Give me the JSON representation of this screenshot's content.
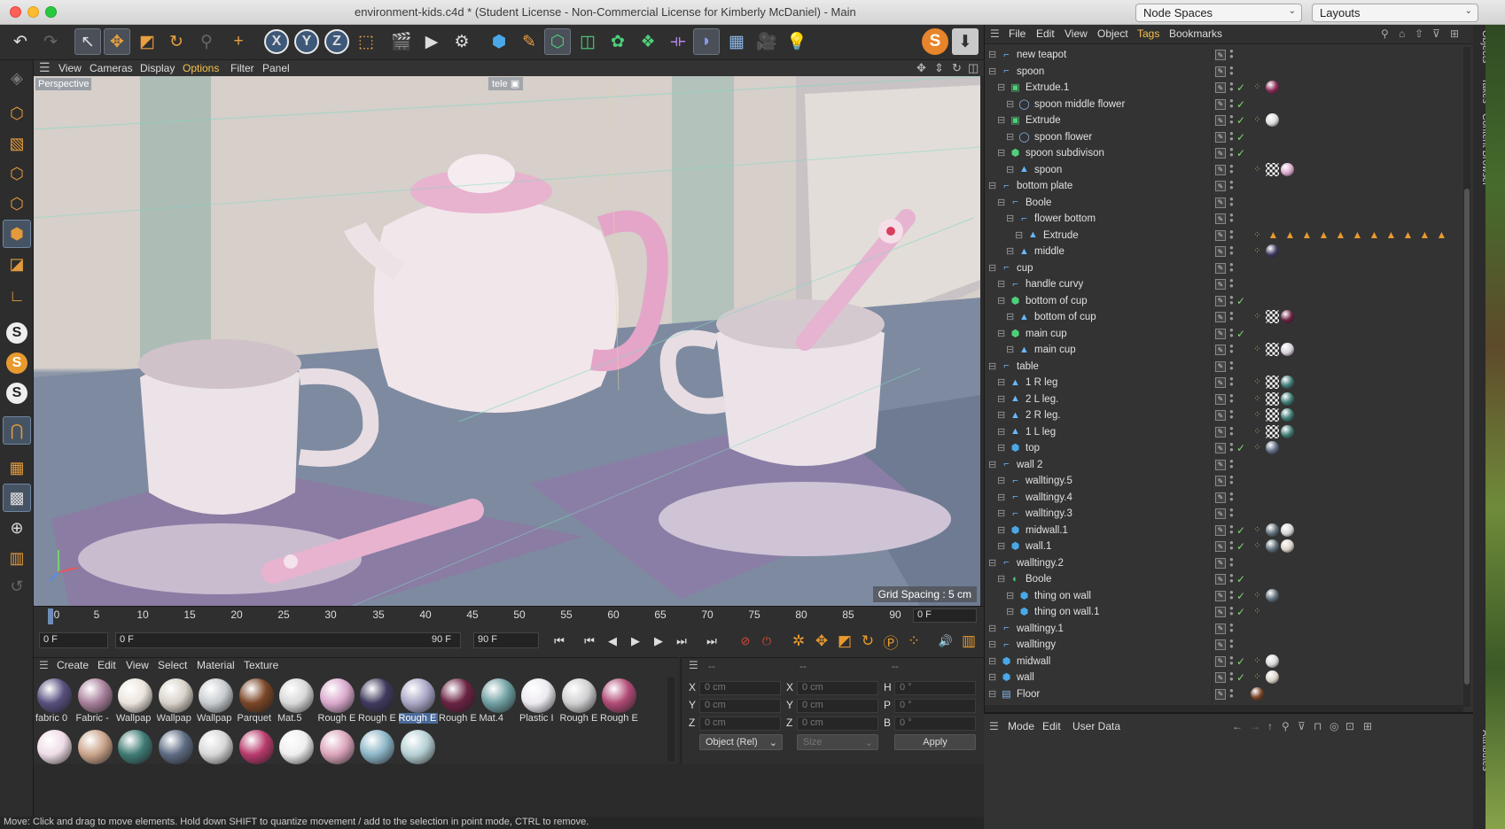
{
  "window": {
    "title": "environment-kids.c4d * (Student License - Non-Commercial License for Kimberly McDaniel) - Main",
    "node_spaces_label": "Node Spaces",
    "layouts_label": "Layouts"
  },
  "viewport": {
    "menu": [
      "View",
      "Cameras",
      "Display",
      "Options",
      "Filter",
      "Panel"
    ],
    "view_label": "Perspective",
    "camera_tag": "tele",
    "grid_spacing": "Grid Spacing : 5 cm"
  },
  "timeline": {
    "ticks": [
      "0",
      "5",
      "10",
      "15",
      "20",
      "25",
      "30",
      "35",
      "40",
      "45",
      "50",
      "55",
      "60",
      "65",
      "70",
      "75",
      "80",
      "85",
      "90"
    ],
    "current_frame": "0 F",
    "start_frame": "0 F",
    "range_start": "0 F",
    "range_end": "90 F",
    "end_frame": "90 F"
  },
  "materials": {
    "menu": [
      "Create",
      "Edit",
      "View",
      "Select",
      "Material",
      "Texture"
    ],
    "row1": [
      {
        "label": "fabric 0",
        "color": "#58507f"
      },
      {
        "label": "Fabric -",
        "color": "#a87f9a"
      },
      {
        "label": "Wallpap",
        "color": "#ebe4dc"
      },
      {
        "label": "Wallpap",
        "color": "#d8d2c8"
      },
      {
        "label": "Wallpap",
        "color": "#c8ccd0"
      },
      {
        "label": "Parquet",
        "color": "#7a4526"
      },
      {
        "label": "Mat.5",
        "color": "#d8d8d8"
      },
      {
        "label": "Rough E",
        "color": "#d9a8cc"
      },
      {
        "label": "Rough E",
        "color": "#3f3a5e"
      },
      {
        "label": "Rough E",
        "color": "#a9a6c6"
      },
      {
        "label": "Rough E",
        "color": "#6b2243"
      },
      {
        "label": "Mat.4",
        "color": "#6f9fa2"
      },
      {
        "label": "Plastic I",
        "color": "#eceaf0"
      },
      {
        "label": "Rough E",
        "color": "#d0d0d2"
      },
      {
        "label": "Rough E",
        "color": "#b14a76"
      }
    ],
    "row2_colors": [
      "#efdce6",
      "#caa38a",
      "#3f7b75",
      "#5d6b82",
      "#d7d7d7",
      "#b83a6c",
      "#eeeeee",
      "#dba4bb",
      "#8cb5c7",
      "#b5d0d4"
    ]
  },
  "coordinates": {
    "headers": [
      "--",
      "--",
      "--"
    ],
    "rows": [
      {
        "a": "X",
        "av": "0 cm",
        "b": "X",
        "bv": "0 cm",
        "c": "H",
        "cv": "0 °"
      },
      {
        "a": "Y",
        "av": "0 cm",
        "b": "Y",
        "bv": "0 cm",
        "c": "P",
        "cv": "0 °"
      },
      {
        "a": "Z",
        "av": "0 cm",
        "b": "Z",
        "bv": "0 cm",
        "c": "B",
        "cv": "0 °"
      }
    ],
    "mode_select": "Object (Rel)",
    "size_select": "Size",
    "apply_label": "Apply"
  },
  "status_text": "Move: Click and drag to move elements. Hold down SHIFT to quantize movement / add to the selection in point mode, CTRL to remove.",
  "object_manager": {
    "menu": [
      "File",
      "Edit",
      "View",
      "Object",
      "Tags",
      "Bookmarks"
    ],
    "rows": [
      {
        "name": "new teapot",
        "depth": 0,
        "icon": "null",
        "check": false,
        "tags": []
      },
      {
        "name": "spoon",
        "depth": 0,
        "icon": "null",
        "check": false,
        "tags": []
      },
      {
        "name": "Extrude.1",
        "depth": 1,
        "icon": "extrude",
        "check": true,
        "tags": [
          "phong",
          "#8a2a55"
        ]
      },
      {
        "name": "spoon middle flower",
        "depth": 2,
        "icon": "spline",
        "check": true,
        "tags": []
      },
      {
        "name": "Extrude",
        "depth": 1,
        "icon": "extrude",
        "check": true,
        "tags": [
          "phong",
          "#dcdcdc"
        ]
      },
      {
        "name": "spoon flower",
        "depth": 2,
        "icon": "spline",
        "check": true,
        "tags": []
      },
      {
        "name": "spoon subdivison",
        "depth": 1,
        "icon": "subdiv",
        "check": true,
        "tags": []
      },
      {
        "name": "spoon",
        "depth": 2,
        "icon": "poly",
        "check": false,
        "tags": [
          "phong",
          "uvw",
          "#d9a8cc"
        ]
      },
      {
        "name": "bottom plate",
        "depth": 0,
        "icon": "null",
        "check": false,
        "tags": []
      },
      {
        "name": "Boole",
        "depth": 1,
        "icon": "null",
        "check": false,
        "tags": []
      },
      {
        "name": "flower bottom",
        "depth": 2,
        "icon": "null",
        "check": false,
        "tags": []
      },
      {
        "name": "Extrude",
        "depth": 3,
        "icon": "poly",
        "check": false,
        "tags": [
          "phong",
          "warn",
          "warn",
          "warn",
          "warn",
          "warn",
          "warn",
          "warn",
          "warn",
          "warn",
          "warn",
          "warn"
        ]
      },
      {
        "name": "middle",
        "depth": 2,
        "icon": "poly",
        "check": false,
        "tags": [
          "phong",
          "#3f3a5e"
        ]
      },
      {
        "name": "cup",
        "depth": 0,
        "icon": "null",
        "check": false,
        "tags": []
      },
      {
        "name": "handle curvy",
        "depth": 1,
        "icon": "null",
        "check": false,
        "tags": []
      },
      {
        "name": "bottom of cup",
        "depth": 1,
        "icon": "subdiv",
        "check": true,
        "tags": []
      },
      {
        "name": "bottom of cup",
        "depth": 2,
        "icon": "poly",
        "check": false,
        "tags": [
          "phong",
          "uvw",
          "#6b2243"
        ]
      },
      {
        "name": "main cup",
        "depth": 1,
        "icon": "subdiv",
        "check": true,
        "tags": []
      },
      {
        "name": "main cup",
        "depth": 2,
        "icon": "poly",
        "check": false,
        "tags": [
          "phong",
          "uvw",
          "#d8d0dc"
        ]
      },
      {
        "name": "table",
        "depth": 0,
        "icon": "null",
        "check": false,
        "tags": []
      },
      {
        "name": "1 R leg",
        "depth": 1,
        "icon": "poly",
        "check": false,
        "tags": [
          "phong",
          "uvw",
          "#3f7b75"
        ]
      },
      {
        "name": "2 L leg.",
        "depth": 1,
        "icon": "poly",
        "check": false,
        "tags": [
          "phong",
          "uvw",
          "#3f7b75"
        ]
      },
      {
        "name": "2 R leg.",
        "depth": 1,
        "icon": "poly",
        "check": false,
        "tags": [
          "phong",
          "uvw",
          "#3f7b75"
        ]
      },
      {
        "name": "1 L leg",
        "depth": 1,
        "icon": "poly",
        "check": false,
        "tags": [
          "phong",
          "uvw",
          "#3f7b75"
        ]
      },
      {
        "name": "top",
        "depth": 1,
        "icon": "cube",
        "check": true,
        "tags": [
          "phong",
          "#5d6b82"
        ]
      },
      {
        "name": "wall  2",
        "depth": 0,
        "icon": "null",
        "check": false,
        "tags": []
      },
      {
        "name": "walltingy.5",
        "depth": 1,
        "icon": "null",
        "check": false,
        "tags": []
      },
      {
        "name": "walltingy.4",
        "depth": 1,
        "icon": "null",
        "check": false,
        "tags": []
      },
      {
        "name": "walltingy.3",
        "depth": 1,
        "icon": "null",
        "check": false,
        "tags": []
      },
      {
        "name": "midwall.1",
        "depth": 1,
        "icon": "cube",
        "check": true,
        "tags": [
          "phong",
          "#5f6f7a",
          "#d7d7d7"
        ]
      },
      {
        "name": "wall.1",
        "depth": 1,
        "icon": "cube",
        "check": true,
        "tags": [
          "phong",
          "#5f6f7a",
          "#d8d2c8"
        ]
      },
      {
        "name": "walltingy.2",
        "depth": 0,
        "icon": "null",
        "check": false,
        "tags": []
      },
      {
        "name": "Boole",
        "depth": 1,
        "icon": "boole",
        "check": true,
        "tags": []
      },
      {
        "name": "thing on wall",
        "depth": 2,
        "icon": "cube",
        "check": true,
        "tags": [
          "phong",
          "#5f6f7a"
        ]
      },
      {
        "name": "thing on wall.1",
        "depth": 2,
        "icon": "cube",
        "check": true,
        "tags": [
          "phong"
        ]
      },
      {
        "name": "walltingy.1",
        "depth": 0,
        "icon": "null",
        "check": false,
        "tags": []
      },
      {
        "name": "walltingy",
        "depth": 0,
        "icon": "null",
        "check": false,
        "tags": []
      },
      {
        "name": "midwall",
        "depth": 0,
        "icon": "cube",
        "check": true,
        "tags": [
          "phong",
          "#d7d7d7"
        ]
      },
      {
        "name": "wall",
        "depth": 0,
        "icon": "cube",
        "check": true,
        "tags": [
          "phong",
          "#d8d2c8"
        ]
      },
      {
        "name": "Floor",
        "depth": 0,
        "icon": "floor",
        "check": false,
        "tags": [
          "#7a4526"
        ]
      }
    ]
  },
  "attribute_manager": {
    "menu": [
      "Mode",
      "Edit",
      "User Data"
    ]
  },
  "right_dock_tabs": [
    "Objects",
    "Takes",
    "Content Browser",
    "Attributes"
  ]
}
